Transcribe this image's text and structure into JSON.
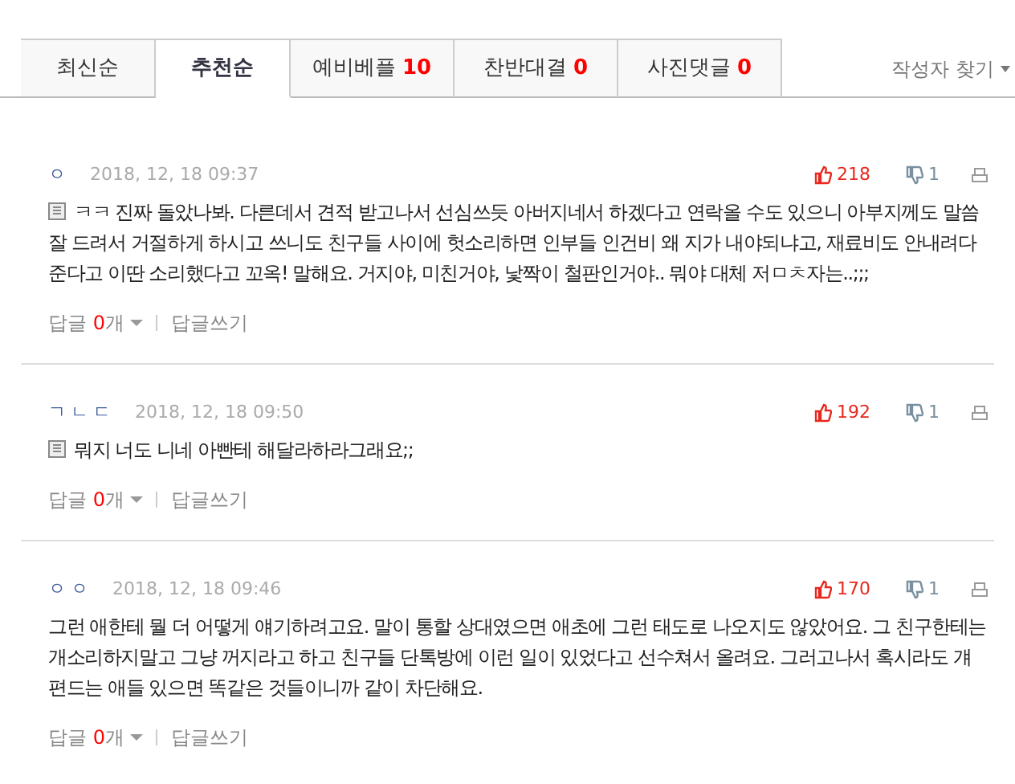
{
  "tabs": [
    {
      "label": "최신순",
      "selected": false
    },
    {
      "label": "추천순",
      "selected": true
    },
    {
      "label": "예비베플",
      "count": "10",
      "selected": false
    },
    {
      "label": "찬반대결",
      "count": "0",
      "selected": false
    },
    {
      "label": "사진댓글",
      "count": "0",
      "selected": false
    }
  ],
  "author_search": "작성자 찾기",
  "comments": [
    {
      "author": "ㅇ",
      "date": "2018, 12, 18 09:37",
      "likes": "218",
      "dislikes": "1",
      "memo": true,
      "text": "ㅋㅋ 진짜 돌았나봐. 다른데서 견적 받고나서 선심쓰듯 아버지네서 하겠다고 연락올 수도 있으니 아부지께도 말씀 잘 드려서 거절하게 하시고 쓰니도 친구들 사이에 헛소리하면 인부들 인건비 왜 지가 내야되냐고, 재료비도 안내려다 준다고 이딴 소리했다고 꼬옥! 말해요. 거지야, 미친거야, 낯짝이 철판인거야.. 뭐야 대체 저ㅁㅊ자는..;;;",
      "reply_label": "답글",
      "reply_count": "0",
      "reply_suffix": "개",
      "write_reply": "답글쓰기"
    },
    {
      "author": "ㄱㄴㄷ",
      "date": "2018, 12, 18 09:50",
      "likes": "192",
      "dislikes": "1",
      "memo": true,
      "text": "뭐지 너도 니네 아빤테 해달라하라그래요;;",
      "reply_label": "답글",
      "reply_count": "0",
      "reply_suffix": "개",
      "write_reply": "답글쓰기"
    },
    {
      "author": "ㅇㅇ",
      "date": "2018, 12, 18 09:46",
      "likes": "170",
      "dislikes": "1",
      "memo": false,
      "text": "그런 애한테 뭘 더 어떻게 얘기하려고요. 말이 통할 상대였으면 애초에 그런 태도로 나오지도 않았어요. 그 친구한테는 개소리하지말고 그냥 꺼지라고 하고 친구들 단톡방에 이런 일이 있었다고 선수쳐서 올려요. 그러고나서 혹시라도 걔 편드는 애들 있으면 똑같은 것들이니까 같이 차단해요.",
      "reply_label": "답글",
      "reply_count": "0",
      "reply_suffix": "개",
      "write_reply": "답글쓰기"
    }
  ]
}
